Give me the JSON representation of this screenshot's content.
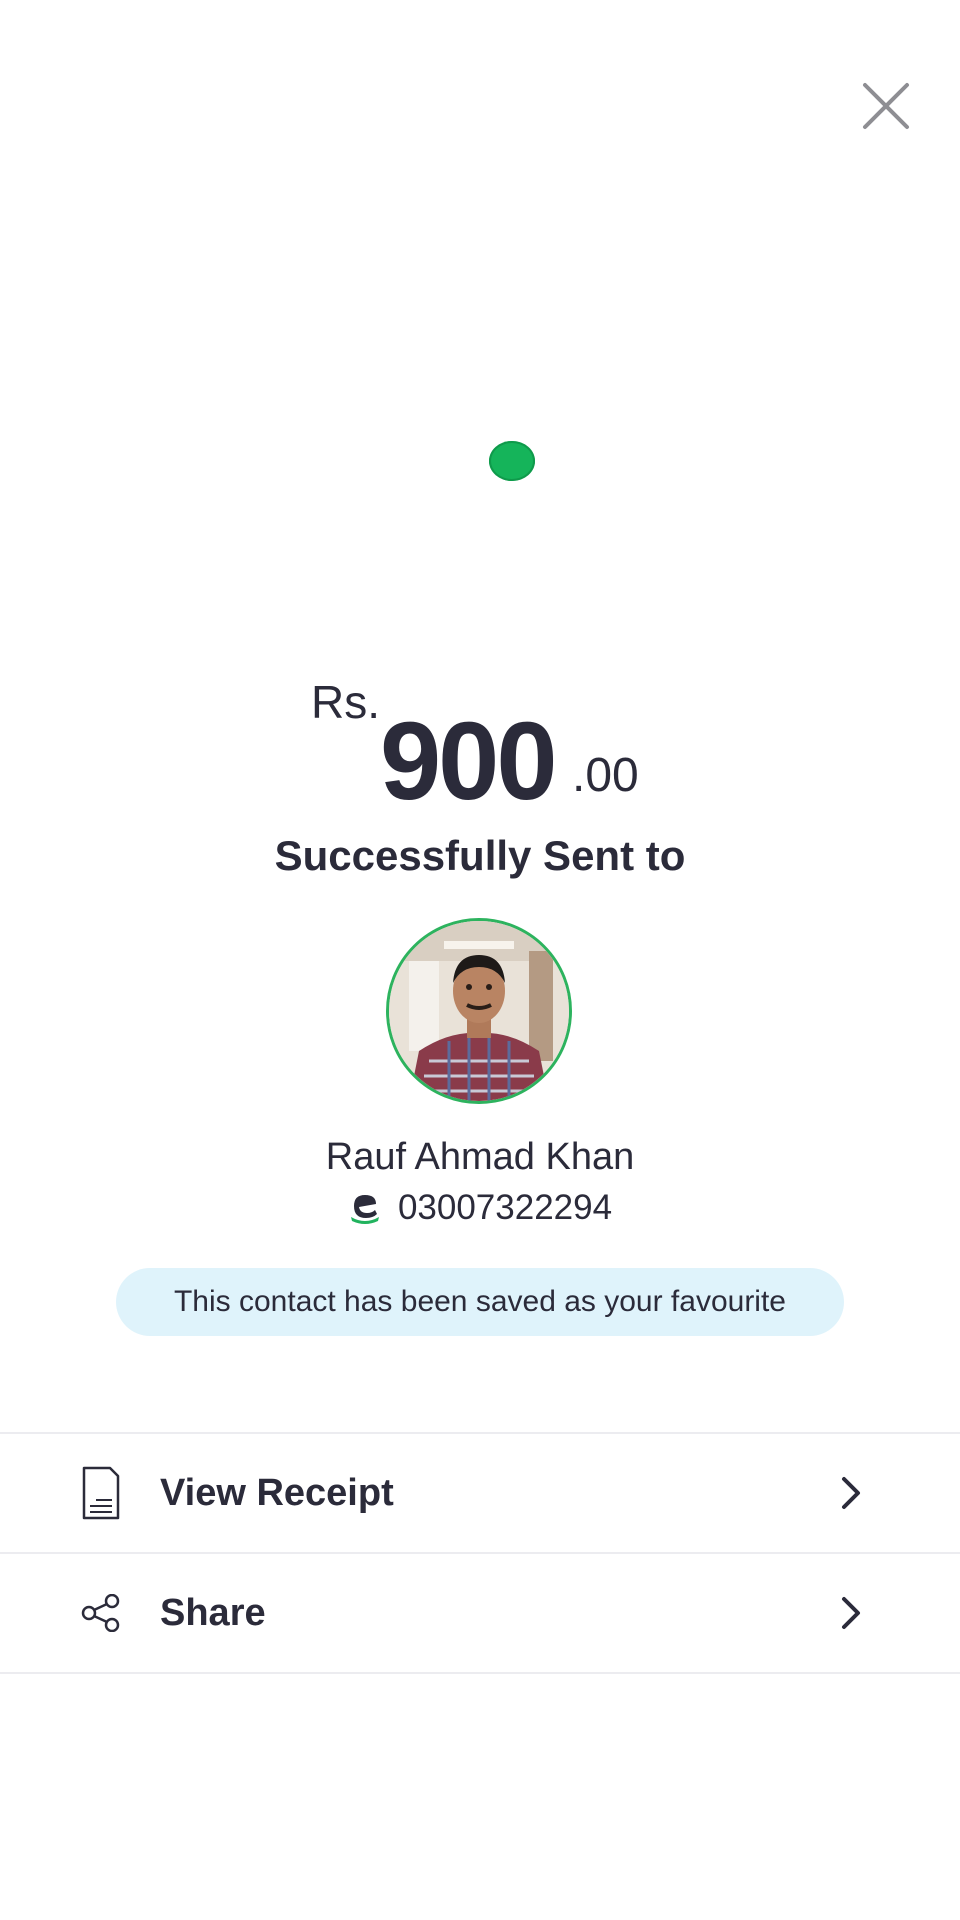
{
  "header": {
    "close_icon": "close-icon"
  },
  "status": {
    "color": "#15b45a"
  },
  "amount": {
    "currency": "Rs.",
    "whole": "900",
    "fraction": ".00"
  },
  "message": {
    "title": "Successfully Sent to"
  },
  "recipient": {
    "name": "Rauf Ahmad Khan",
    "number": "03007322294",
    "network_icon": "easypaisa-logo-icon",
    "avatar_border_color": "#2db35e"
  },
  "banner": {
    "text": "This contact has been saved as your favourite",
    "background": "#dff3fb"
  },
  "menu": {
    "items": [
      {
        "label": "View Receipt",
        "icon": "receipt-icon"
      },
      {
        "label": "Share",
        "icon": "share-icon"
      }
    ]
  }
}
